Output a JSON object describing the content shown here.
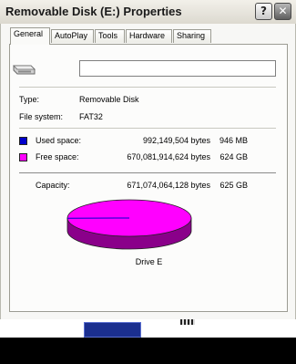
{
  "window": {
    "title": "Removable Disk (E:) Properties",
    "help_button": "?",
    "close_button": "✕"
  },
  "tabs": [
    "General",
    "AutoPlay",
    "Tools",
    "Hardware",
    "Sharing"
  ],
  "active_tab": "General",
  "general": {
    "label_value": "",
    "type_label": "Type:",
    "type_value": "Removable Disk",
    "fs_label": "File system:",
    "fs_value": "FAT32",
    "used_label": "Used space:",
    "used_bytes": "992,149,504 bytes",
    "used_size": "946 MB",
    "free_label": "Free space:",
    "free_bytes": "670,081,914,624 bytes",
    "free_size": "624 GB",
    "capacity_label": "Capacity:",
    "capacity_bytes": "671,074,064,128 bytes",
    "capacity_size": "625 GB",
    "drive_label": "Drive E",
    "used_fraction": 0.0015
  },
  "colors": {
    "used": "#0000cc",
    "free": "#ff00ff",
    "free_side": "#8a008a"
  },
  "icons": {
    "drive": "removable-drive-icon",
    "help": "help-icon",
    "close": "close-icon"
  }
}
